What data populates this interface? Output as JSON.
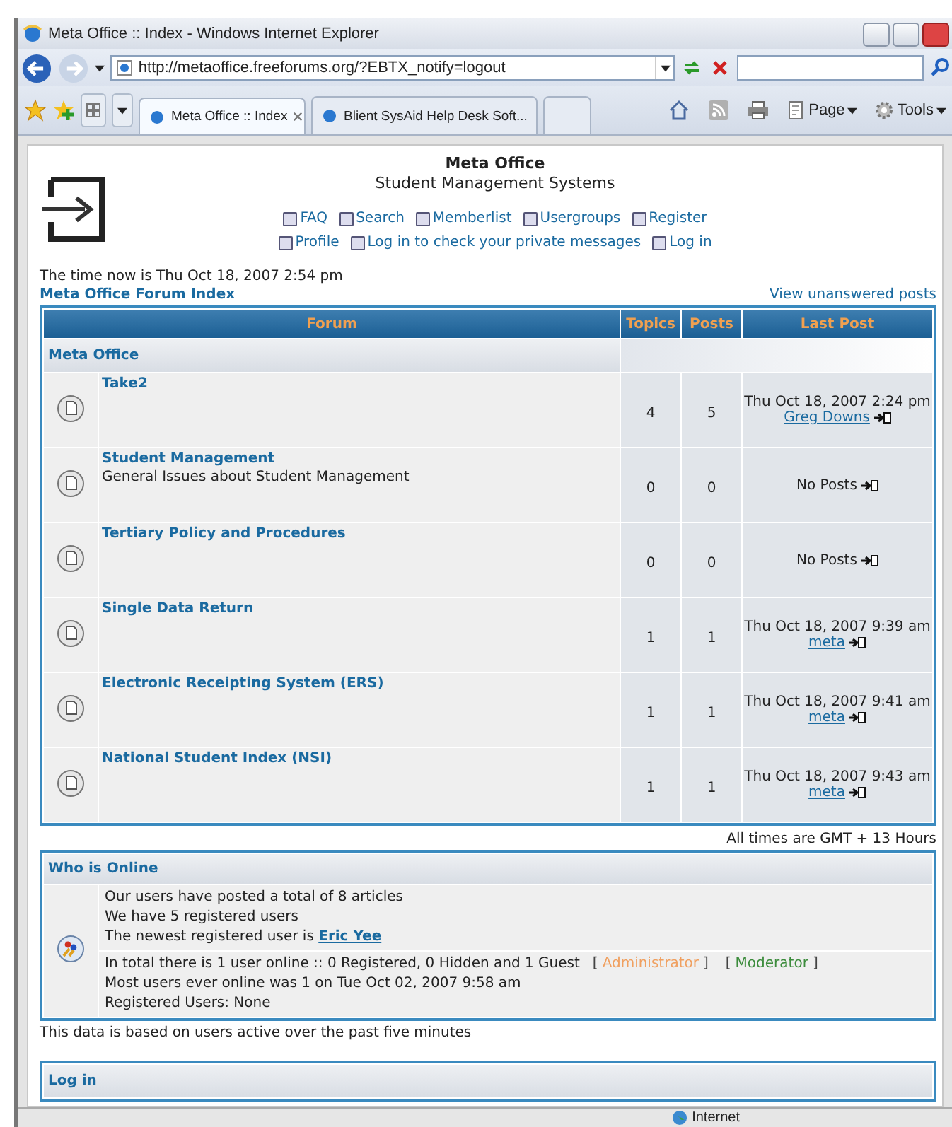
{
  "window": {
    "title": "Meta Office :: Index - Windows Internet Explorer"
  },
  "address": {
    "url": "http://metaoffice.freeforums.org/?EBTX_notify=logout"
  },
  "tabs": [
    {
      "label": "Meta Office :: Index",
      "selected": true
    },
    {
      "label": "Blient SysAid Help Desk Soft...",
      "selected": false
    }
  ],
  "toolbar": [
    {
      "label": "Page"
    },
    {
      "label": "Tools"
    }
  ],
  "header": {
    "title": "Meta Office",
    "subtitle": "Student Management Systems"
  },
  "nav_rows": [
    [
      {
        "label": "FAQ"
      },
      {
        "label": "Search"
      },
      {
        "label": "Memberlist"
      },
      {
        "label": "Usergroups"
      },
      {
        "label": "Register"
      }
    ],
    [
      {
        "label": "Profile"
      },
      {
        "label": "Log in to check your private messages"
      },
      {
        "label": "Log in"
      }
    ]
  ],
  "time_now": "The time now is Thu Oct 18, 2007 2:54 pm",
  "breadcrumb": "Meta Office Forum Index",
  "unanswered_link": "View unanswered posts",
  "table": {
    "columns": [
      "Forum",
      "Topics",
      "Posts",
      "Last Post"
    ],
    "category": "Meta Office",
    "rows": [
      {
        "name": "Take2",
        "topics": "4",
        "posts": "5",
        "last_post": {
          "date": "Thu Oct 18, 2007 2:24 pm",
          "author": "Greg Downs"
        }
      },
      {
        "name": "Student Management",
        "description": "General Issues about Student Management",
        "topics": "0",
        "posts": "0",
        "last_post": {
          "text": "No Posts"
        }
      },
      {
        "name": "Tertiary Policy and Procedures",
        "topics": "0",
        "posts": "0",
        "last_post": {
          "text": "No Posts"
        }
      },
      {
        "name": "Single Data Return",
        "topics": "1",
        "posts": "1",
        "last_post": {
          "date": "Thu Oct 18, 2007 9:39 am",
          "author": "meta"
        }
      },
      {
        "name": "Electronic Receipting System (ERS)",
        "topics": "1",
        "posts": "1",
        "last_post": {
          "date": "Thu Oct 18, 2007 9:41 am",
          "author": "meta"
        }
      },
      {
        "name": "National Student Index (NSI)",
        "topics": "1",
        "posts": "1",
        "last_post": {
          "date": "Thu Oct 18, 2007 9:43 am",
          "author": "meta"
        }
      }
    ]
  },
  "timezone_note": "All times are GMT + 13 Hours",
  "who_is_online": {
    "title": "Who is Online",
    "stats": [
      "Our users have posted a total of 8 articles",
      "We have 5 registered users"
    ],
    "newest_label": "The newest registered user is",
    "newest_user": "Eric Yee",
    "online": "In total there is 1 user online :: 0 Registered, 0 Hidden and 1 Guest",
    "legend": [
      {
        "open": "[",
        "label": "Administrator",
        "close": "]",
        "color": "#f0a060"
      },
      {
        "open": "[",
        "label": "Moderator",
        "close": "]",
        "color": "#3c8c3c"
      }
    ],
    "details": [
      "Most users ever online was 1 on Tue Oct 02, 2007 9:58 am",
      "Registered Users: None"
    ]
  },
  "footer_note": "This data is based on users active over the past five minutes",
  "login_title": "Log in",
  "status_bar": {
    "zone": "Internet"
  }
}
